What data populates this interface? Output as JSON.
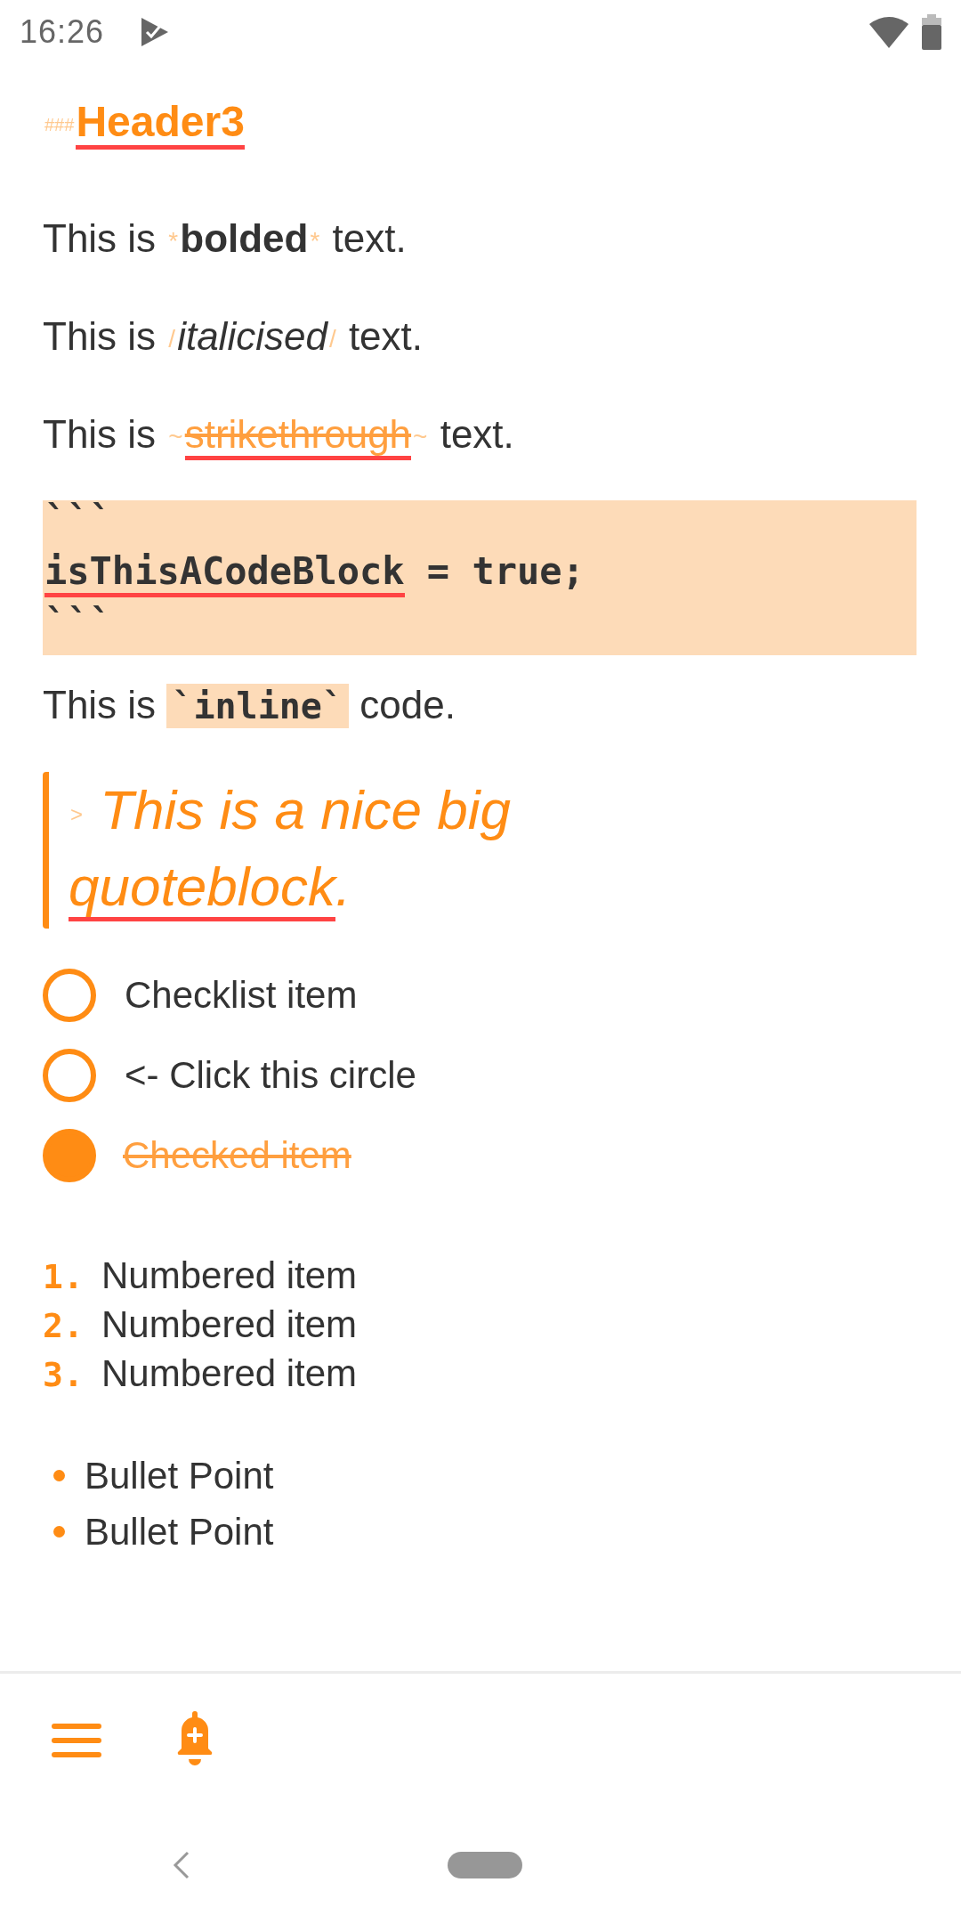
{
  "status_bar": {
    "time": "16:26"
  },
  "editor": {
    "blocks": [
      {
        "kind": "heading",
        "segments": [
          {
            "kind": "marker",
            "text": "###"
          },
          {
            "kind": "heading",
            "text": "Header3",
            "misspelled": true
          }
        ]
      },
      {
        "kind": "paragraph",
        "segments": [
          {
            "kind": "plain",
            "text": "This is ",
            "misspelled": false
          },
          {
            "kind": "marker",
            "text": "*"
          },
          {
            "kind": "bold",
            "text": "bolded",
            "misspelled": false
          },
          {
            "kind": "marker",
            "text": "*"
          },
          {
            "kind": "plain",
            "text": " text.",
            "misspelled": false
          }
        ]
      },
      {
        "kind": "paragraph",
        "segments": [
          {
            "kind": "plain",
            "text": "This is ",
            "misspelled": false
          },
          {
            "kind": "marker",
            "text": "/"
          },
          {
            "kind": "italic",
            "text": "italicised",
            "misspelled": false
          },
          {
            "kind": "marker",
            "text": "/"
          },
          {
            "kind": "plain",
            "text": " text.",
            "misspelled": false
          }
        ]
      },
      {
        "kind": "paragraph",
        "segments": [
          {
            "kind": "plain",
            "text": "This is ",
            "misspelled": false
          },
          {
            "kind": "marker",
            "text": "~"
          },
          {
            "kind": "strike",
            "text": "strikethrough",
            "misspelled": true
          },
          {
            "kind": "marker",
            "text": "~"
          },
          {
            "kind": "plain",
            "text": " text.",
            "misspelled": false
          }
        ]
      },
      {
        "kind": "code_block",
        "lines": [
          [
            {
              "text": "```",
              "misspelled": false
            }
          ],
          [
            {
              "text": "isThisACodeBlock",
              "misspelled": true
            },
            {
              "text": " = true;",
              "misspelled": false
            }
          ],
          [
            {
              "text": "```",
              "misspelled": false
            }
          ]
        ]
      },
      {
        "kind": "paragraph",
        "segments": [
          {
            "kind": "plain",
            "text": "This is ",
            "misspelled": false
          },
          {
            "kind": "inline_code",
            "text": "`inline`",
            "misspelled": false
          },
          {
            "kind": "plain",
            "text": " code.",
            "misspelled": false
          }
        ]
      },
      {
        "kind": "quote",
        "segments": [
          {
            "kind": "marker",
            "text": ">"
          },
          {
            "kind": "quote",
            "text": " This is a nice big ",
            "misspelled": false
          },
          {
            "kind": "quote",
            "text": "quoteblock",
            "misspelled": true
          },
          {
            "kind": "quote",
            "text": ".",
            "misspelled": false
          }
        ]
      },
      {
        "kind": "checklist",
        "items": [
          {
            "text": "Checklist item",
            "checked": false
          },
          {
            "text": "<- Click this circle",
            "checked": false
          },
          {
            "text": "Checked item",
            "checked": true
          }
        ]
      },
      {
        "kind": "numbered",
        "items": [
          {
            "number": "1.",
            "text": "Numbered item"
          },
          {
            "number": "2.",
            "text": "Numbered item"
          },
          {
            "number": "3.",
            "text": "Numbered item"
          }
        ]
      },
      {
        "kind": "bullets",
        "items": [
          {
            "text": "Bullet Point"
          },
          {
            "text": "Bullet Point"
          }
        ]
      }
    ]
  }
}
